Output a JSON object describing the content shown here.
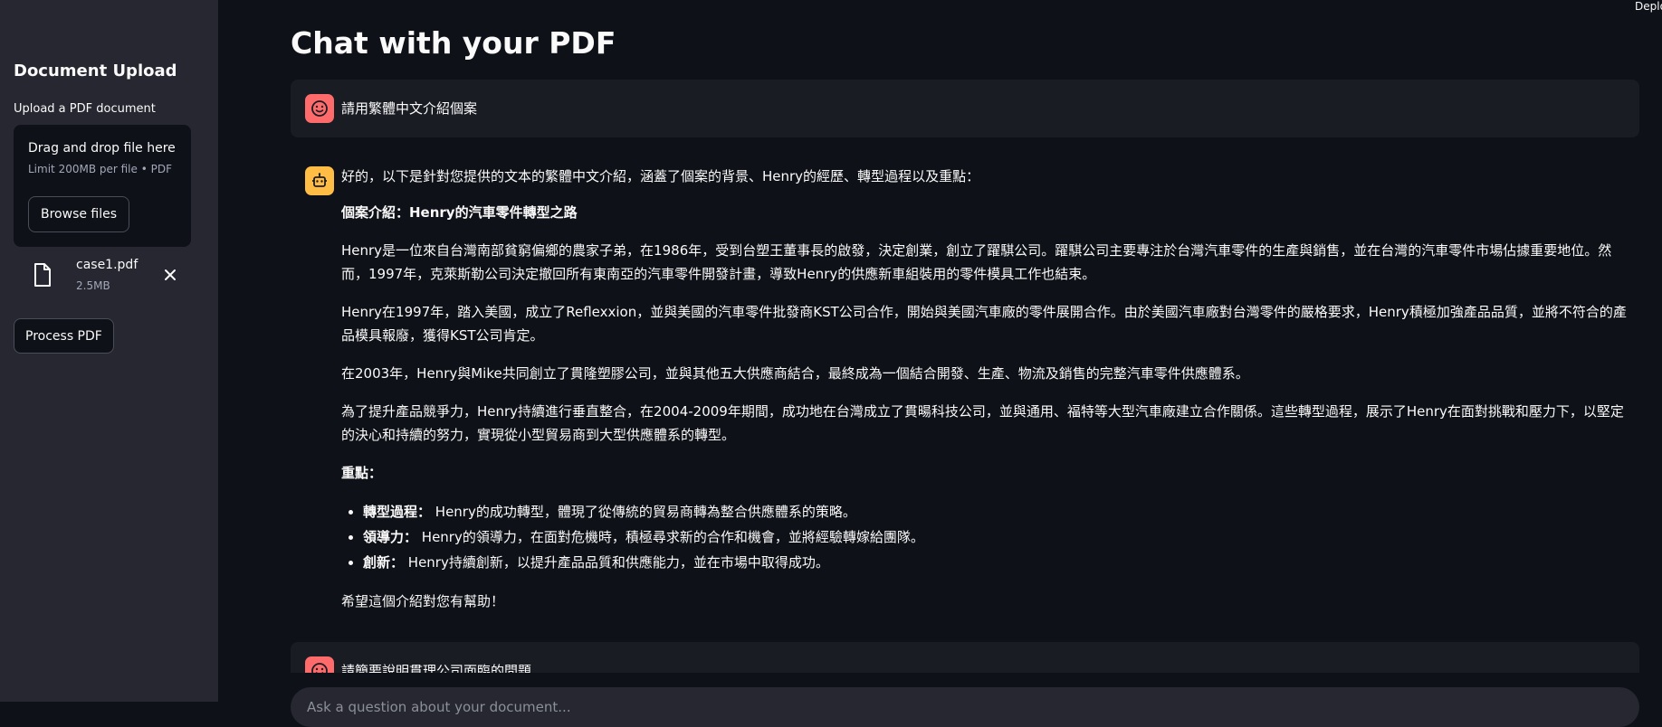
{
  "sidebar": {
    "title": "Document Upload",
    "upload_label": "Upload a PDF document",
    "dropzone": {
      "main_text": "Drag and drop file here",
      "limit_text": "Limit 200MB per file • PDF",
      "browse_label": "Browse files"
    },
    "file": {
      "name": "case1.pdf",
      "size": "2.5MB"
    },
    "process_label": "Process PDF"
  },
  "deploy_label": "Deploy",
  "main": {
    "title": "Chat with your PDF",
    "messages": [
      {
        "role": "user",
        "text": "請用繁體中文介紹個案"
      },
      {
        "role": "assistant",
        "intro": "好的，以下是針對您提供的文本的繁體中文介紹，涵蓋了個案的背景、Henry的經歷、轉型過程以及重點：",
        "heading": "個案介紹：Henry的汽車零件轉型之路",
        "paragraphs": [
          "Henry是一位來自台灣南部貧窮偏鄉的農家子弟，在1986年，受到台塑王董事長的啟發，決定創業，創立了躍騏公司。躍騏公司主要專注於台灣汽車零件的生產與銷售，並在台灣的汽車零件市場佔據重要地位。然而，1997年，克萊斯勒公司決定撤回所有東南亞的汽車零件開發計畫，導致Henry的供應新車組裝用的零件模具工作也結束。",
          "Henry在1997年，踏入美國，成立了Reflexxion，並與美國的汽車零件批發商KST公司合作，開始與美國汽車廠的零件展開合作。由於美國汽車廠對台灣零件的嚴格要求，Henry積極加強產品品質，並將不符合的產品模具報廢，獲得KST公司肯定。",
          "在2003年，Henry與Mike共同創立了貫隆塑膠公司，並與其他五大供應商結合，最終成為一個結合開發、生產、物流及銷售的完整汽車零件供應體系。",
          "為了提升產品競爭力，Henry持續進行垂直整合，在2004-2009年期間，成功地在台灣成立了貫暘科技公司，並與通用、福特等大型汽車廠建立合作關係。這些轉型過程，展示了Henry在面對挑戰和壓力下，以堅定的決心和持續的努力，實現從小型貿易商到大型供應體系的轉型。"
        ],
        "key_heading": "重點：",
        "key_points": [
          {
            "label": "轉型過程：",
            "text": " Henry的成功轉型，體現了從傳統的貿易商轉為整合供應體系的策略。"
          },
          {
            "label": "領導力：",
            "text": " Henry的領導力，在面對危機時，積極尋求新的合作和機會，並將經驗轉嫁給團隊。"
          },
          {
            "label": "創新：",
            "text": " Henry持續創新，以提升產品品質和供應能力，並在市場中取得成功。"
          }
        ],
        "closing": "希望這個介紹對您有幫助！"
      },
      {
        "role": "user",
        "text": "請簡要說明貫理公司面臨的問題"
      }
    ],
    "chat_input_placeholder": "Ask a question about your document..."
  },
  "colors": {
    "background": "#0e1117",
    "sidebar": "#262730",
    "user_avatar": "#ff6b6b",
    "bot_avatar": "#ffbd45"
  }
}
